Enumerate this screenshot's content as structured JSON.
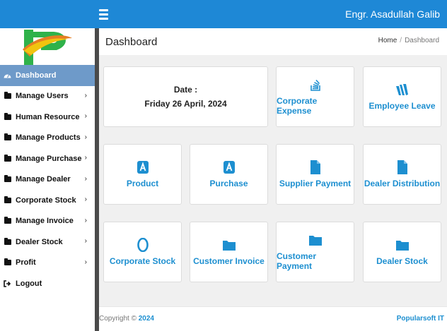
{
  "header": {
    "username": "Engr. Asadullah Galib"
  },
  "sidebar": {
    "items": [
      {
        "label": "Dashboard",
        "icon": "dashboard-icon",
        "active": true,
        "chevron": false
      },
      {
        "label": "Manage Users",
        "icon": "folder-icon",
        "chevron": true
      },
      {
        "label": "Human Resource",
        "icon": "folder-icon",
        "chevron": true
      },
      {
        "label": "Manage Products",
        "icon": "folder-icon",
        "chevron": true
      },
      {
        "label": "Manage Purchase",
        "icon": "folder-icon",
        "chevron": true
      },
      {
        "label": "Manage Dealer",
        "icon": "folder-icon",
        "chevron": true
      },
      {
        "label": "Corporate Stock",
        "icon": "folder-icon",
        "chevron": true
      },
      {
        "label": "Manage Invoice",
        "icon": "folder-icon",
        "chevron": true
      },
      {
        "label": "Dealer Stock",
        "icon": "folder-icon",
        "chevron": true
      },
      {
        "label": "Profit",
        "icon": "folder-icon",
        "chevron": true
      },
      {
        "label": "Logout",
        "icon": "logout-icon",
        "chevron": false
      }
    ],
    "chevron_glyph": "›"
  },
  "main": {
    "title": "Dashboard",
    "breadcrumb": {
      "home": "Home",
      "separator": "/",
      "current": "Dashboard"
    },
    "date": {
      "label": "Date :",
      "value": "Friday 26 April, 2024"
    },
    "cards": [
      {
        "label": "Corporate Expense",
        "icon": "stack-overflow-icon"
      },
      {
        "label": "Employee Leave",
        "icon": "wallet-icon"
      },
      {
        "label": "Product",
        "icon": "app-store-icon"
      },
      {
        "label": "Purchase",
        "icon": "app-store-icon"
      },
      {
        "label": "Supplier Payment",
        "icon": "file-icon"
      },
      {
        "label": "Dealer Distribution",
        "icon": "file-icon"
      },
      {
        "label": "Corporate Stock",
        "icon": "opera-icon"
      },
      {
        "label": "Customer Invoice",
        "icon": "folder-icon"
      },
      {
        "label": "Customer Payment",
        "icon": "folder-icon"
      },
      {
        "label": "Dealer Stock",
        "icon": "folder-icon"
      }
    ]
  },
  "footer": {
    "copyright_prefix": "Copyright ©",
    "year": "2024",
    "company": "Popularsoft IT"
  },
  "colors": {
    "topbar": "#1e88d6",
    "accent": "#1d8fd0",
    "active_item": "#6e9ac9",
    "sidebar_scroll": "#4a4a4a"
  }
}
